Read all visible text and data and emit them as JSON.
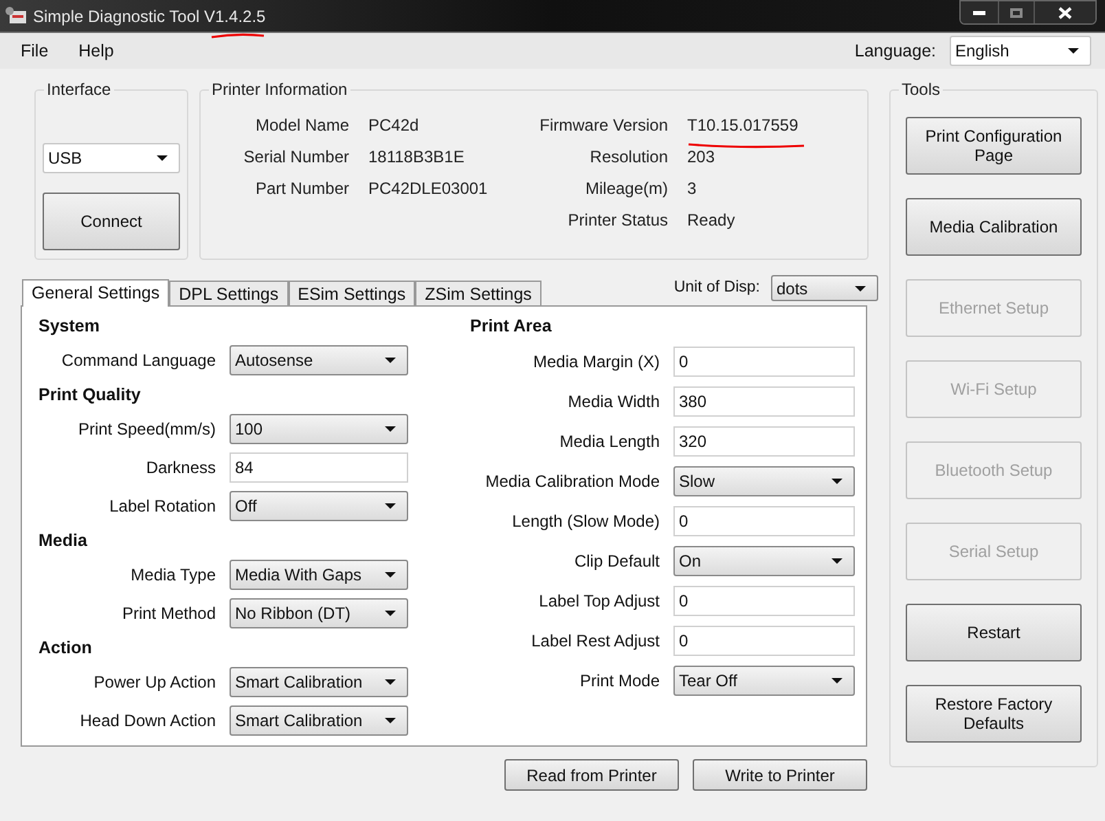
{
  "window": {
    "title": "Simple Diagnostic Tool V1.4.2.5"
  },
  "menu": [
    "File",
    "Help"
  ],
  "language": {
    "label": "Language:",
    "value": "English"
  },
  "interface": {
    "title": "Interface",
    "value": "USB",
    "button": "Connect"
  },
  "printer_info": {
    "title": "Printer Information",
    "columns": [
      [
        {
          "label": "Model Name",
          "value": "PC42d"
        },
        {
          "label": "Serial Number",
          "value": "18118B3B1E"
        },
        {
          "label": "Part Number",
          "value": "PC42DLE03001"
        }
      ],
      [
        {
          "label": "Firmware Version",
          "value": "T10.15.017559"
        },
        {
          "label": "Resolution",
          "value": "203"
        },
        {
          "label": "Mileage(m)",
          "value": "3"
        },
        {
          "label": "Printer Status",
          "value": "Ready"
        }
      ]
    ]
  },
  "tabs": [
    {
      "label": "General Settings",
      "selected": true
    },
    {
      "label": "DPL Settings",
      "selected": false
    },
    {
      "label": "ESim Settings",
      "selected": false
    },
    {
      "label": "ZSim Settings",
      "selected": false
    }
  ],
  "unit": {
    "label": "Unit of Disp:",
    "value": "dots"
  },
  "settings": [
    [
      {
        "heading": "System",
        "rows": [
          {
            "label": "Command Language",
            "kind": "select",
            "value": "Autosense"
          }
        ]
      },
      {
        "heading": "Print Quality",
        "rows": [
          {
            "label": "Print Speed(mm/s)",
            "kind": "select",
            "value": "100"
          },
          {
            "label": "Darkness",
            "kind": "input",
            "value": "84"
          },
          {
            "label": "Label Rotation",
            "kind": "select",
            "value": "Off"
          }
        ]
      },
      {
        "heading": "Media",
        "rows": [
          {
            "label": "Media Type",
            "kind": "select",
            "value": "Media With Gaps"
          },
          {
            "label": "Print Method",
            "kind": "select",
            "value": "No Ribbon (DT)"
          }
        ]
      },
      {
        "heading": "Action",
        "rows": [
          {
            "label": "Power Up Action",
            "kind": "select",
            "value": "Smart Calibration"
          },
          {
            "label": "Head Down Action",
            "kind": "select",
            "value": "Smart Calibration"
          }
        ]
      }
    ],
    [
      {
        "heading": "Print Area",
        "rows": [
          {
            "label": "Media Margin (X)",
            "kind": "input",
            "value": "0"
          },
          {
            "label": "Media Width",
            "kind": "input",
            "value": "380"
          },
          {
            "label": "Media Length",
            "kind": "input",
            "value": "320"
          },
          {
            "label": "Media Calibration Mode",
            "kind": "select",
            "value": "Slow"
          },
          {
            "label": "Length (Slow Mode)",
            "kind": "input",
            "value": "0"
          },
          {
            "label": "Clip Default",
            "kind": "select",
            "value": "On"
          },
          {
            "label": "Label Top Adjust",
            "kind": "input",
            "value": "0"
          },
          {
            "label": "Label Rest Adjust",
            "kind": "input",
            "value": "0"
          },
          {
            "label": "Print Mode",
            "kind": "select",
            "value": "Tear Off"
          }
        ]
      }
    ]
  ],
  "actions": [
    "Read from Printer",
    "Write to Printer"
  ],
  "tools": {
    "title": "Tools",
    "buttons": [
      {
        "label": "Print Configuration Page",
        "disabled": false
      },
      {
        "label": "Media Calibration",
        "disabled": false
      },
      {
        "label": "Ethernet Setup",
        "disabled": true
      },
      {
        "label": "Wi-Fi Setup",
        "disabled": true
      },
      {
        "label": "Bluetooth Setup",
        "disabled": true
      },
      {
        "label": "Serial Setup",
        "disabled": true
      },
      {
        "label": "Restart",
        "disabled": false
      },
      {
        "label": "Restore Factory Defaults",
        "disabled": false
      }
    ]
  }
}
